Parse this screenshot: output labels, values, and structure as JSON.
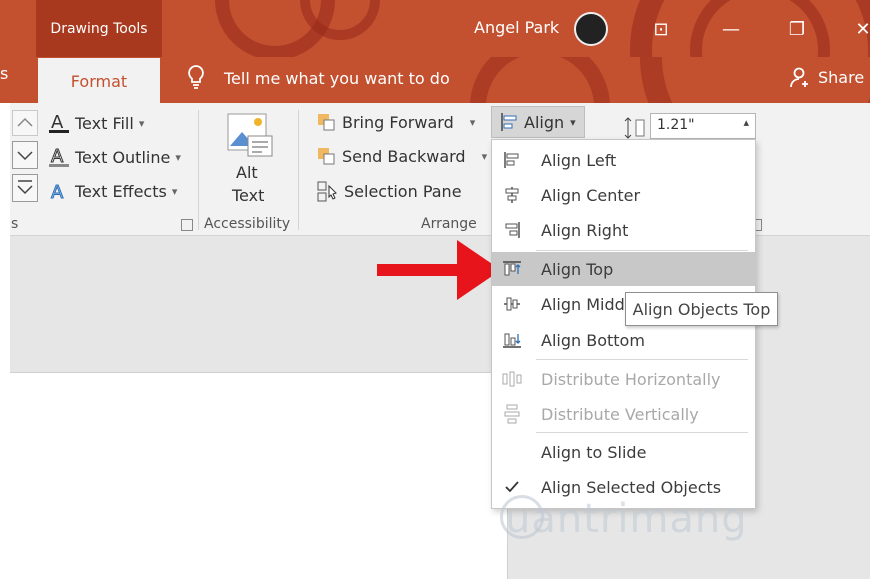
{
  "titlebar": {
    "context_tab": "Drawing Tools",
    "user_name": "Angel Park",
    "restore_glyph": "⊡",
    "minimize_glyph": "—",
    "maximize_glyph": "❐",
    "close_glyph": "✕"
  },
  "tabs": {
    "active_tab": "Format",
    "tell_me": "Tell me what you want to do",
    "share": "Share"
  },
  "ribbon": {
    "text_fill": "Text Fill",
    "text_outline": "Text Outline",
    "text_effects": "Text Effects",
    "group_left_fragment": "s",
    "alt_text_line1": "Alt",
    "alt_text_line2": "Text",
    "accessibility": "Accessibility",
    "bring_forward": "Bring Forward",
    "send_backward": "Send Backward",
    "selection_pane": "Selection Pane",
    "arrange": "Arrange",
    "align": "Align",
    "height_value": "1.21\"",
    "dropdown_caret": "▾",
    "spin_up": "▴"
  },
  "align_menu": {
    "items": [
      {
        "label": "Align Left",
        "icon": "align-left-icon",
        "enabled": true
      },
      {
        "label": "Align Center",
        "icon": "align-center-icon",
        "enabled": true
      },
      {
        "label": "Align Right",
        "icon": "align-right-icon",
        "enabled": true
      },
      {
        "label": "Align Top",
        "icon": "align-top-icon",
        "enabled": true,
        "highlighted": true
      },
      {
        "label": "Align Midd",
        "icon": "align-middle-icon",
        "enabled": true
      },
      {
        "label": "Align Bottom",
        "icon": "align-bottom-icon",
        "enabled": true
      },
      {
        "label": "Distribute Horizontally",
        "icon": "distribute-horizontally-icon",
        "enabled": false
      },
      {
        "label": "Distribute Vertically",
        "icon": "distribute-vertically-icon",
        "enabled": false
      },
      {
        "label": "Align to Slide",
        "icon": "",
        "enabled": true
      },
      {
        "label": "Align Selected Objects",
        "icon": "checkmark-icon",
        "enabled": true,
        "checked": true
      }
    ],
    "tooltip": "Align Objects Top"
  },
  "watermark": "uantrimang",
  "colors": {
    "accent": "#c3502f",
    "ribbon_bg": "#f2f2f2",
    "arrow": "#e8141b"
  }
}
